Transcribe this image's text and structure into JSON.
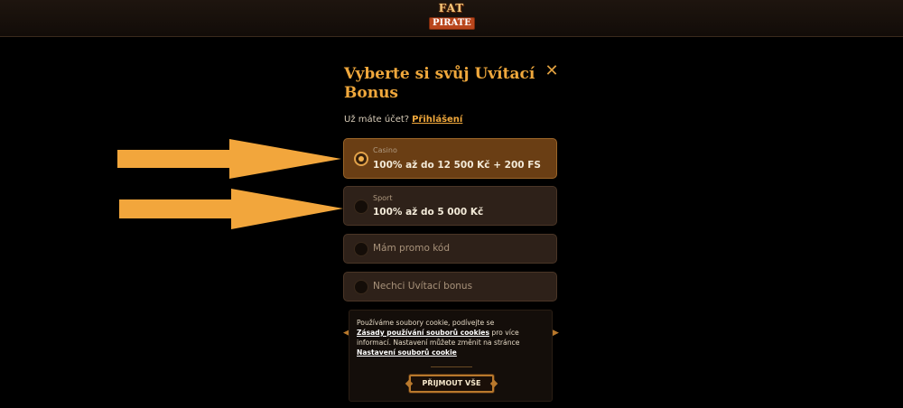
{
  "header": {
    "logo_line1": "FAT",
    "logo_line2": "PIRATE"
  },
  "modal": {
    "title": "Vyberte si svůj Uvítací Bonus",
    "close_label": "✕",
    "login_prompt": "Už máte účet?",
    "login_link": "Přihlášení"
  },
  "options": [
    {
      "category": "Casino",
      "value": "100% až do 12 500 Kč + 200 FS",
      "selected": true
    },
    {
      "category": "Sport",
      "value": "100% až do 5 000 Kč",
      "selected": false
    },
    {
      "label": "Mám promo kód",
      "selected": false
    },
    {
      "label": "Nechci Uvítací bonus",
      "selected": false
    }
  ],
  "cookie": {
    "text_before": "Používáme soubory cookie, podívejte se",
    "policy_link": "Zásady používání souborů cookies",
    "text_middle": "pro více informací. Nastavení můžete změnit na stránce",
    "settings_link": "Nastavení souborů cookie",
    "accept_label": "PŘIJMOUT VŠE"
  },
  "colors": {
    "accent": "#f0a83c",
    "arrow": "#f2a63c",
    "selected_option": "#6a3e14",
    "option_bg": "#2e2119"
  },
  "icons": {
    "close": "close-icon",
    "arrow": "arrow-right-icon"
  }
}
